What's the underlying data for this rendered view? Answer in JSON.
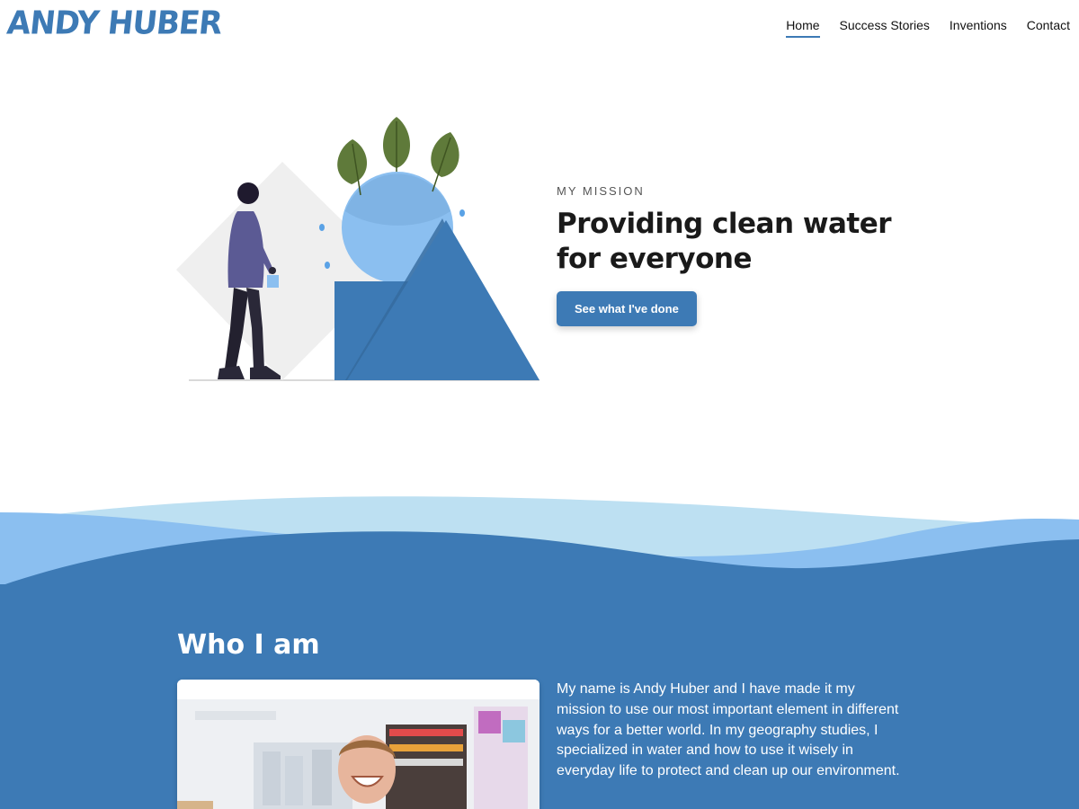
{
  "brand": {
    "logo_text": "ANDY HUBER",
    "accent_color": "#3d7ab5"
  },
  "nav": {
    "items": [
      {
        "label": "Home",
        "active": true
      },
      {
        "label": "Success Stories",
        "active": false
      },
      {
        "label": "Inventions",
        "active": false
      },
      {
        "label": "Contact",
        "active": false
      }
    ]
  },
  "hero": {
    "eyebrow": "MY MISSION",
    "headline_line1": "Providing clean water",
    "headline_line2": "for everyone",
    "cta_label": "See what I've done",
    "illustration_icon": "person-water-mountain-illustration"
  },
  "about": {
    "title": "Who I am",
    "bio": "My name is Andy Huber and I have made it my mission to use our most important element in different ways for a better world. In my geography studies, I specialized in water and how to use it wisely in everyday life to protect and clean up our environment.",
    "photo_icon": "portrait-photo"
  },
  "colors": {
    "section_blue": "#3d7ab5",
    "wave_light": "#bde0f2",
    "wave_mid": "#8bbff0"
  }
}
